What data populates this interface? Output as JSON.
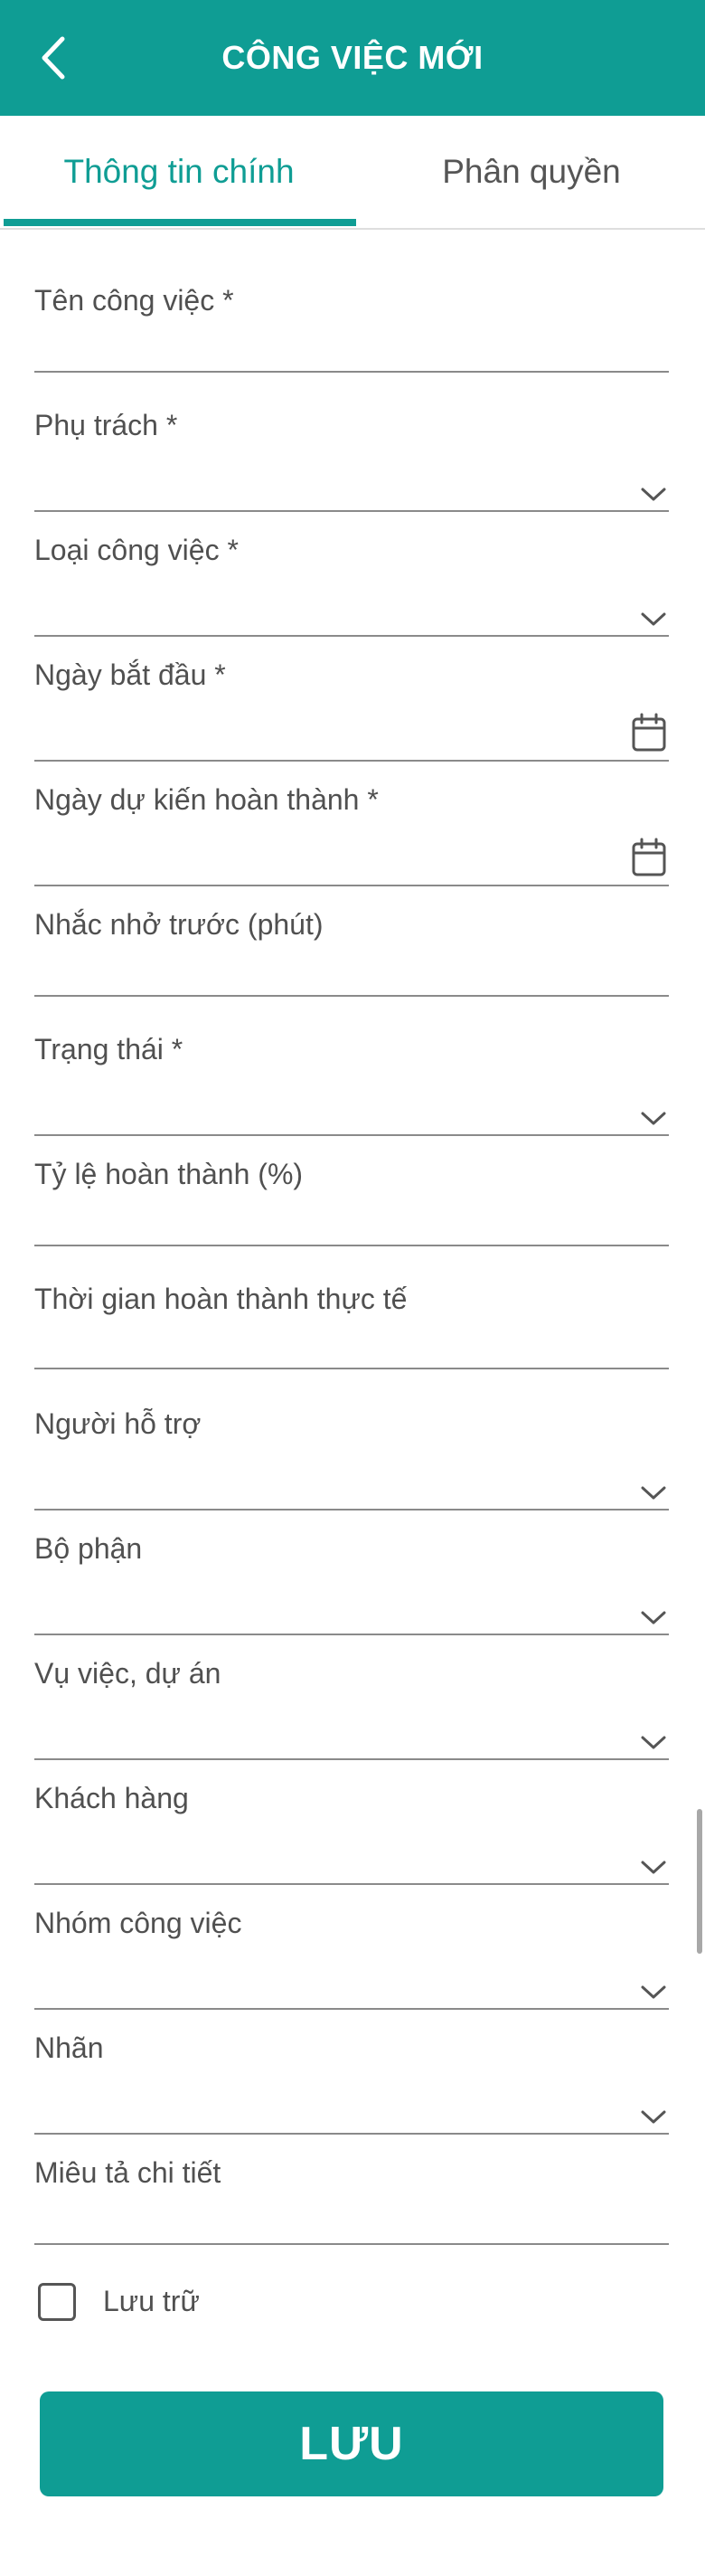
{
  "header": {
    "title": "CÔNG VIỆC MỚI",
    "back_icon": "chevron-left-icon"
  },
  "tabs": [
    {
      "label": "Thông tin chính",
      "active": true
    },
    {
      "label": "Phân quyền",
      "active": false
    }
  ],
  "form": {
    "fields": [
      {
        "label": "Tên công việc *",
        "kind": "text",
        "value": ""
      },
      {
        "label": "Phụ trách *",
        "kind": "dropdown",
        "value": ""
      },
      {
        "label": "Loại công việc *",
        "kind": "dropdown",
        "value": ""
      },
      {
        "label": "Ngày bắt đầu *",
        "kind": "date",
        "value": ""
      },
      {
        "label": "Ngày dự kiến hoàn thành *",
        "kind": "date",
        "value": ""
      },
      {
        "label": "Nhắc nhở trước (phút)",
        "kind": "text",
        "value": ""
      },
      {
        "label": "Trạng thái *",
        "kind": "dropdown",
        "value": ""
      },
      {
        "label": "Tỷ lệ hoàn thành (%)",
        "kind": "text",
        "value": ""
      },
      {
        "label": "Thời gian hoàn thành thực tế",
        "kind": "text",
        "value": ""
      },
      {
        "label": "Người hỗ trợ",
        "kind": "dropdown",
        "value": ""
      },
      {
        "label": "Bộ phận",
        "kind": "dropdown",
        "value": ""
      },
      {
        "label": "Vụ việc, dự án",
        "kind": "dropdown",
        "value": ""
      },
      {
        "label": "Khách hàng",
        "kind": "dropdown",
        "value": ""
      },
      {
        "label": "Nhóm công việc",
        "kind": "dropdown",
        "value": ""
      },
      {
        "label": "Nhãn",
        "kind": "dropdown",
        "value": ""
      },
      {
        "label": "Miêu tả chi tiết",
        "kind": "text",
        "value": ""
      }
    ],
    "archive": {
      "label": "Lưu trữ",
      "checked": false
    },
    "save_label": "LƯU"
  },
  "colors": {
    "accent": "#0f9d94",
    "text": "#505050",
    "line": "#8a8a8a"
  }
}
